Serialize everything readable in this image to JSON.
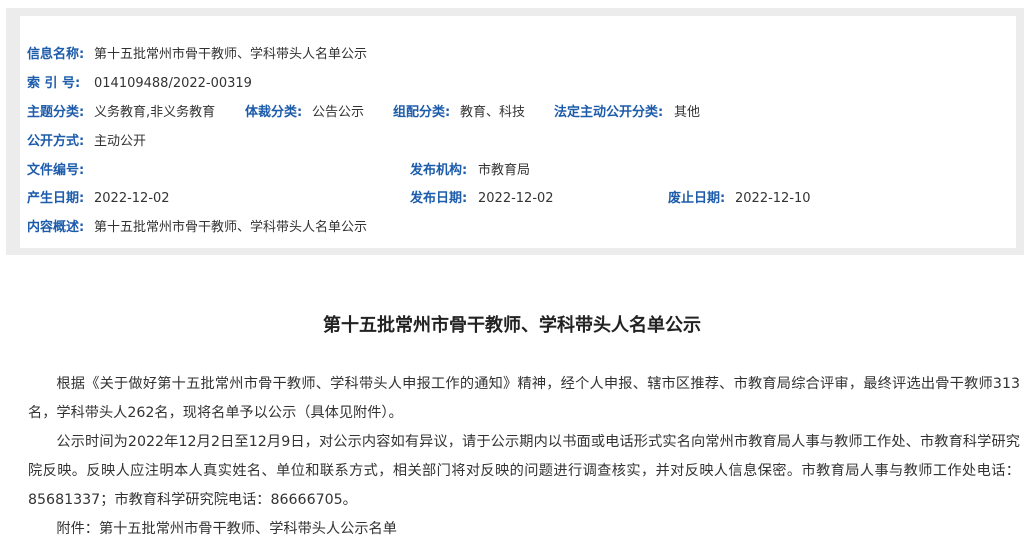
{
  "meta": {
    "info_name": {
      "label": "信息名称:",
      "value": "第十五批常州市骨干教师、学科带头人名单公示"
    },
    "index_no": {
      "label": "索 引 号:",
      "value": "014109488/2022-00319"
    },
    "topic": {
      "label": "主题分类:",
      "value": "义务教育,非义务教育"
    },
    "genre": {
      "label": "体裁分类:",
      "value": "公告公示"
    },
    "org": {
      "label": "组配分类:",
      "value": "教育、科技"
    },
    "legal": {
      "label": "法定主动公开分类:",
      "value": "其他"
    },
    "open_mode": {
      "label": "公开方式:",
      "value": "主动公开"
    },
    "doc_no": {
      "label": "文件编号:",
      "value": ""
    },
    "publisher": {
      "label": "发布机构:",
      "value": "市教育局"
    },
    "created": {
      "label": "产生日期:",
      "value": "2022-12-02"
    },
    "published": {
      "label": "发布日期:",
      "value": "2022-12-02"
    },
    "expired": {
      "label": "废止日期:",
      "value": "2022-12-10"
    },
    "summary": {
      "label": "内容概述:",
      "value": "第十五批常州市骨干教师、学科带头人名单公示"
    }
  },
  "article": {
    "title": "第十五批常州市骨干教师、学科带头人名单公示",
    "paragraphs": [
      "根据《关于做好第十五批常州市骨干教师、学科带头人申报工作的通知》精神，经个人申报、辖市区推荐、市教育局综合评审，最终评选出骨干教师313名，学科带头人262名，现将名单予以公示（具体见附件）。",
      "公示时间为2022年12月2日至12月9日，对公示内容如有异议，请于公示期内以书面或电话形式实名向常州市教育局人事与教师工作处、市教育科学研究院反映。反映人应注明本人真实姓名、单位和联系方式，相关部门将对反映的问题进行调查核实，并对反映人信息保密。市教育局人事与教师工作处电话：85681337；市教育科学研究院电话：86666705。",
      "附件：第十五批常州市骨干教师、学科带头人公示名单"
    ]
  }
}
